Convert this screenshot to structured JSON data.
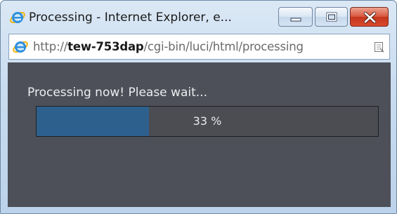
{
  "window": {
    "title": "Processing - Internet Explorer, e...",
    "url_prefix": "http://",
    "url_host": "tew-753dap",
    "url_path": "/cgi-bin/luci/html/processing"
  },
  "page": {
    "message": "Processing now! Please wait...",
    "progress_label": "33 %",
    "progress_percent": 33
  },
  "colors": {
    "content_bg": "#4d5058",
    "progress_fill": "#2e608e",
    "close_button": "#c5361c"
  },
  "icons": [
    "internet-explorer-icon",
    "minimize-icon",
    "maximize-icon",
    "close-icon",
    "compatibility-view-icon"
  ]
}
